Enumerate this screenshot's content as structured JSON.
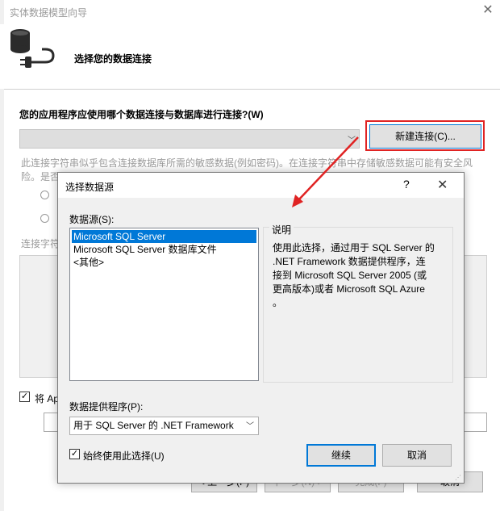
{
  "wizard": {
    "title": "实体数据模型向导",
    "header_title": "选择您的数据连接",
    "question": "您的应用程序应使用哪个数据连接与数据库进行连接?(W)",
    "new_connection_button": "新建连接(C)...",
    "sensitive_text_line1": "此连接字符串似乎包含连接数据库所需的敏感数据(例如密码)。在连接字符串中存储敏感数据可能有安全风",
    "sensitive_text_line2": "险。是否",
    "connection_string_label": "连接字符",
    "save_label": "将 Ap",
    "buttons": {
      "prev": "< 上一步(P)",
      "next": "下一步(N) >",
      "finish": "完成(F)",
      "cancel": "取消"
    }
  },
  "dialog": {
    "title": "选择数据源",
    "help_glyph": "?",
    "datasource_label": "数据源(S):",
    "datasources": [
      "Microsoft SQL Server",
      "Microsoft SQL Server 数据库文件",
      "<其他>"
    ],
    "selected_index": 0,
    "description_title": "说明",
    "description_lines": [
      "使用此选择，通过用于 SQL Server 的",
      ".NET Framework 数据提供程序，连",
      "接到 Microsoft SQL Server 2005 (或",
      "更高版本)或者 Microsoft SQL Azure",
      "。"
    ],
    "provider_label": "数据提供程序(P):",
    "provider_value": "用于 SQL Server 的 .NET Framework",
    "always_use_label": "始终使用此选择(U)",
    "always_use_checked": true,
    "continue_button": "继续",
    "cancel_button": "取消"
  },
  "icons": {
    "close": "close-icon",
    "checkmark": "✓",
    "dropdown": "chevron-down-icon",
    "database": "database-plug-icon"
  },
  "colors": {
    "accent": "#0078d7",
    "annotation_red": "#e02323"
  }
}
